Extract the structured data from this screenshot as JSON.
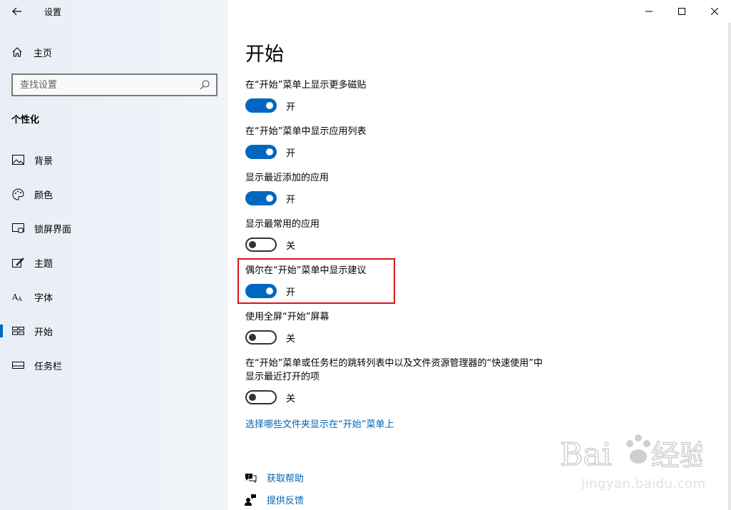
{
  "window": {
    "title": "设置"
  },
  "sidebar": {
    "home_label": "主页",
    "search_placeholder": "查找设置",
    "section_title": "个性化",
    "items": [
      {
        "label": "背景",
        "icon": "image-icon"
      },
      {
        "label": "颜色",
        "icon": "palette-icon"
      },
      {
        "label": "锁屏界面",
        "icon": "lock-screen-icon"
      },
      {
        "label": "主题",
        "icon": "theme-brush-icon"
      },
      {
        "label": "字体",
        "icon": "font-icon"
      },
      {
        "label": "开始",
        "icon": "start-icon",
        "active": true
      },
      {
        "label": "任务栏",
        "icon": "taskbar-icon"
      }
    ]
  },
  "main": {
    "page_title": "开始",
    "settings": [
      {
        "description": "在“开始”菜单上显示更多磁贴",
        "state": "开",
        "on": true
      },
      {
        "description": "在“开始”菜单中显示应用列表",
        "state": "开",
        "on": true
      },
      {
        "description": "显示最近添加的应用",
        "state": "开",
        "on": true
      },
      {
        "description": "显示最常用的应用",
        "state": "关",
        "on": false
      },
      {
        "description": "偶尔在“开始”菜单中显示建议",
        "state": "开",
        "on": true
      },
      {
        "description": "使用全屏“开始”屏幕",
        "state": "关",
        "on": false
      },
      {
        "description_line1": "在“开始”菜单或任务栏的跳转列表中以及文件资源管理器的“快速使用”中",
        "description_line2": "显示最近打开的项",
        "state": "关",
        "on": false
      }
    ],
    "folders_link": "选择哪些文件夹显示在“开始”菜单上",
    "help": {
      "get_help": "获取帮助",
      "feedback": "提供反馈"
    }
  },
  "watermark": {
    "brand": "Baidu经验",
    "url": "jingyan.baidu.com"
  },
  "colors": {
    "accent": "#0067c0",
    "link": "#0063b1",
    "highlight": "#d9141c",
    "sidebar_bg": "#eef2f8"
  }
}
